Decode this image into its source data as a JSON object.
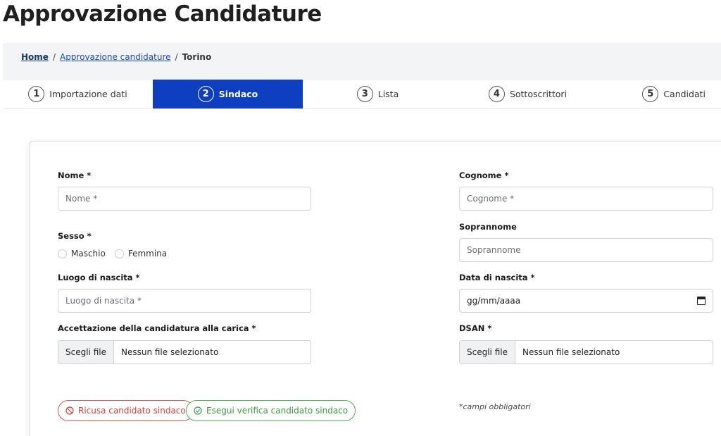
{
  "page": {
    "title": "Approvazione Candidature"
  },
  "breadcrumb": {
    "home": "Home",
    "section": "Approvazione candidature",
    "current": "Torino",
    "separator": "/"
  },
  "steps": [
    {
      "num": "1",
      "label": "Importazione dati"
    },
    {
      "num": "2",
      "label": "Sindaco"
    },
    {
      "num": "3",
      "label": "Lista"
    },
    {
      "num": "4",
      "label": "Sottoscrittori"
    },
    {
      "num": "5",
      "label": "Candidati"
    }
  ],
  "form": {
    "nome": {
      "label": "Nome *",
      "placeholder": "Nome *"
    },
    "cognome": {
      "label": "Cognome *",
      "placeholder": "Cognome *"
    },
    "sesso": {
      "label": "Sesso *",
      "options": [
        "Maschio",
        "Femmina"
      ]
    },
    "soprannome": {
      "label": "Soprannome",
      "placeholder": "Soprannome"
    },
    "luogo": {
      "label": "Luogo di nascita *",
      "placeholder": "Luogo di nascita *"
    },
    "data": {
      "label": "Data di nascita *",
      "value": "gg/mm/aaaa"
    },
    "accettazione": {
      "label": "Accettazione della candidatura alla carica *",
      "button": "Scegli file",
      "status": "Nessun file selezionato"
    },
    "dsan": {
      "label": "DSAN *",
      "button": "Scegli file",
      "status": "Nessun file selezionato"
    }
  },
  "actions": {
    "reject": "Ricusa candidato sindaco",
    "verify": "Esegui verifica candidato sindaco"
  },
  "required_note": "*campi obbligatori",
  "colors": {
    "primary": "#0f3fc1",
    "danger": "#d43f3a",
    "success": "#3c9a40",
    "link": "#1a49c6"
  }
}
